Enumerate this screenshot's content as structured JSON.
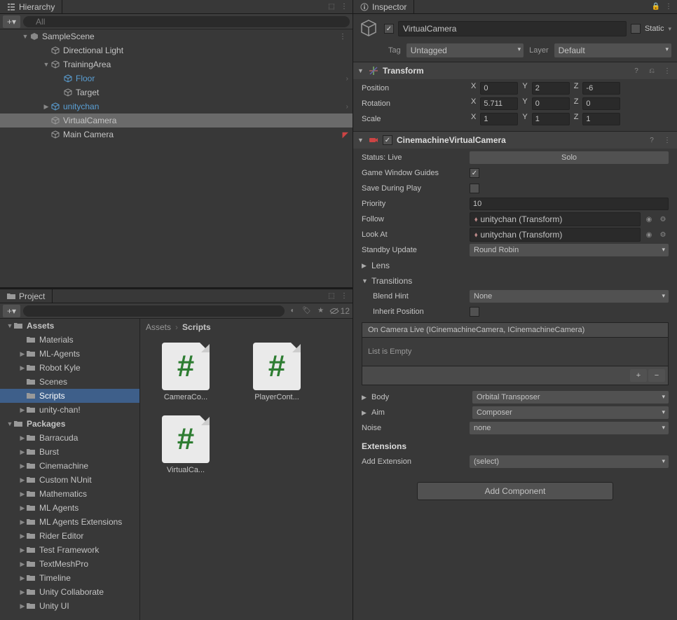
{
  "hierarchy": {
    "tab": "Hierarchy",
    "searchPlaceholder": "All",
    "items": [
      {
        "label": "SampleScene",
        "indent": 0,
        "expanded": true,
        "icon": "scene",
        "hasMenu": true
      },
      {
        "label": "Directional Light",
        "indent": 1,
        "icon": "cube"
      },
      {
        "label": "TrainingArea",
        "indent": 1,
        "icon": "cube",
        "expanded": true
      },
      {
        "label": "Floor",
        "indent": 2,
        "icon": "cube",
        "blue": true,
        "hasChevron": true
      },
      {
        "label": "Target",
        "indent": 2,
        "icon": "cube"
      },
      {
        "label": "unitychan",
        "indent": 1,
        "icon": "cube",
        "blue": true,
        "collapsed": true,
        "hasChevron": true
      },
      {
        "label": "VirtualCamera",
        "indent": 1,
        "icon": "cube",
        "selected": true
      },
      {
        "label": "Main Camera",
        "indent": 1,
        "icon": "cube",
        "warning": true
      }
    ]
  },
  "project": {
    "tab": "Project",
    "hiddenCount": "12",
    "breadcrumb": [
      "Assets",
      "Scripts"
    ],
    "tree": [
      {
        "label": "Assets",
        "indent": 0,
        "expanded": true,
        "bold": true
      },
      {
        "label": "Materials",
        "indent": 1
      },
      {
        "label": "ML-Agents",
        "indent": 1,
        "collapsed": true
      },
      {
        "label": "Robot Kyle",
        "indent": 1,
        "collapsed": true
      },
      {
        "label": "Scenes",
        "indent": 1
      },
      {
        "label": "Scripts",
        "indent": 1,
        "selected": true
      },
      {
        "label": "unity-chan!",
        "indent": 1,
        "collapsed": true
      },
      {
        "label": "Packages",
        "indent": 0,
        "expanded": true,
        "bold": true
      },
      {
        "label": "Barracuda",
        "indent": 1,
        "collapsed": true
      },
      {
        "label": "Burst",
        "indent": 1,
        "collapsed": true
      },
      {
        "label": "Cinemachine",
        "indent": 1,
        "collapsed": true
      },
      {
        "label": "Custom NUnit",
        "indent": 1,
        "collapsed": true
      },
      {
        "label": "Mathematics",
        "indent": 1,
        "collapsed": true
      },
      {
        "label": "ML Agents",
        "indent": 1,
        "collapsed": true
      },
      {
        "label": "ML Agents Extensions",
        "indent": 1,
        "collapsed": true
      },
      {
        "label": "Rider Editor",
        "indent": 1,
        "collapsed": true
      },
      {
        "label": "Test Framework",
        "indent": 1,
        "collapsed": true
      },
      {
        "label": "TextMeshPro",
        "indent": 1,
        "collapsed": true
      },
      {
        "label": "Timeline",
        "indent": 1,
        "collapsed": true
      },
      {
        "label": "Unity Collaborate",
        "indent": 1,
        "collapsed": true
      },
      {
        "label": "Unity UI",
        "indent": 1,
        "collapsed": true
      }
    ],
    "items": [
      {
        "label": "CameraCo..."
      },
      {
        "label": "PlayerCont..."
      },
      {
        "label": "VirtualCa..."
      }
    ]
  },
  "inspector": {
    "tab": "Inspector",
    "name": "VirtualCamera",
    "enabled": true,
    "staticLabel": "Static",
    "tagLabel": "Tag",
    "tag": "Untagged",
    "layerLabel": "Layer",
    "layer": "Default",
    "transform": {
      "title": "Transform",
      "positionLabel": "Position",
      "position": {
        "x": "0",
        "y": "2",
        "z": "-6"
      },
      "rotationLabel": "Rotation",
      "rotation": {
        "x": "5.711",
        "y": "0",
        "z": "0"
      },
      "scaleLabel": "Scale",
      "scale": {
        "x": "1",
        "y": "1",
        "z": "1"
      }
    },
    "vcam": {
      "title": "CinemachineVirtualCamera",
      "statusLabel": "Status: Live",
      "soloLabel": "Solo",
      "guidesLabel": "Game Window Guides",
      "guides": true,
      "saveLabel": "Save During Play",
      "save": false,
      "priorityLabel": "Priority",
      "priority": "10",
      "followLabel": "Follow",
      "follow": "unitychan (Transform)",
      "lookAtLabel": "Look At",
      "lookAt": "unitychan (Transform)",
      "standbyLabel": "Standby Update",
      "standby": "Round Robin",
      "lensLabel": "Lens",
      "transitionsLabel": "Transitions",
      "blendHintLabel": "Blend Hint",
      "blendHint": "None",
      "inheritLabel": "Inherit Position",
      "inherit": false,
      "eventTitle": "On Camera Live (ICinemachineCamera, ICinemachineCamera)",
      "eventEmpty": "List is Empty",
      "bodyLabel": "Body",
      "body": "Orbital Transposer",
      "aimLabel": "Aim",
      "aim": "Composer",
      "noiseLabel": "Noise",
      "noise": "none",
      "extensionsTitle": "Extensions",
      "addExtLabel": "Add Extension",
      "addExt": "(select)"
    },
    "addComponent": "Add Component"
  }
}
